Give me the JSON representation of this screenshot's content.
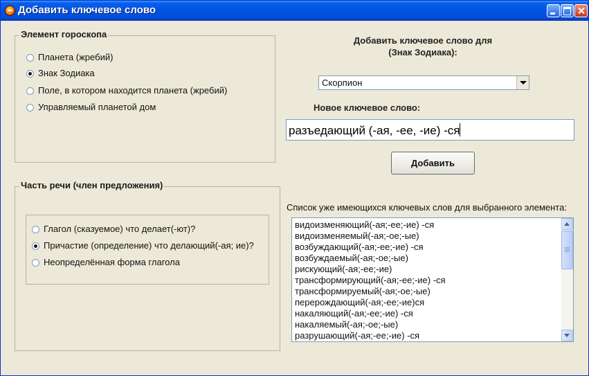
{
  "window": {
    "title": "Добавить ключевое слово"
  },
  "horoscope_group": {
    "title": "Элемент гороскопа",
    "options": [
      {
        "label": "Планета (жребий)",
        "checked": false
      },
      {
        "label": "Знак Зодиака",
        "checked": true
      },
      {
        "label": "Поле, в котором находится планета (жребий)",
        "checked": false
      },
      {
        "label": "Управляемый планетой дом",
        "checked": false
      }
    ]
  },
  "speech_group": {
    "title": "Часть речи (член предложения)",
    "options": [
      {
        "label": "Глагол (сказуемое) что делает(-ют)?",
        "checked": false
      },
      {
        "label": "Причастие (определение) что делающий(-ая; ие)?",
        "checked": true
      },
      {
        "label": "Неопределённая форма глагола",
        "checked": false
      }
    ]
  },
  "add_for": {
    "line1": "Добавить ключевое слово для",
    "line2": "(Знак Зодиака):"
  },
  "zodiac_select": {
    "value": "Скорпион"
  },
  "new_keyword": {
    "label": "Новое ключевое слово:",
    "value": "разъедающий (-ая, -ее, -ие) -ся"
  },
  "add_button": {
    "label": "Добавить"
  },
  "existing_list": {
    "label": "Список уже имеющихся ключевых слов для выбранного элемента:",
    "items": [
      "видоизменяющий(-ая;-ее;-ие) -ся",
      "видоизменяемый(-ая;-ое;-ые)",
      "возбуждающий(-ая;-ее;-ие) -ся",
      "возбуждаемый(-ая;-ое;-ые)",
      "рискующий(-ая;-ее;-ие)",
      "трансформирующий(-ая;-ее;-ие) -ся",
      "трансформируемый(-ая;-ое;-ые)",
      "перерождающий(-ая;-ее;-ие)ся",
      "накаляющий(-ая;-ее;-ие) -ся",
      "накаляемый(-ая;-ое;-ые)",
      "разрушающий(-ая;-ее;-ие) -ся"
    ]
  },
  "colors": {
    "titlebar": "#0054e3",
    "face": "#ece9d8"
  }
}
